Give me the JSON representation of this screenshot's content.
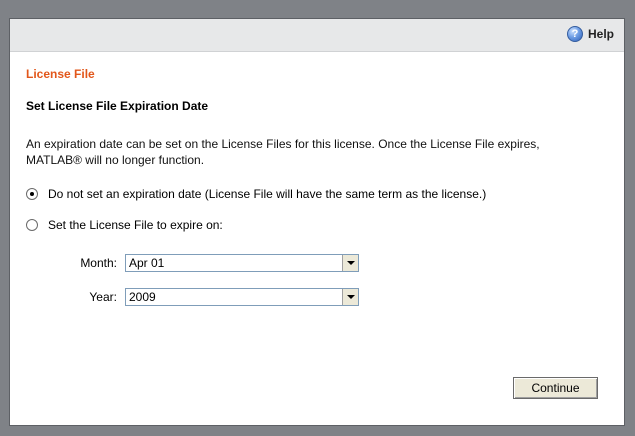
{
  "header": {
    "help_label": "Help",
    "help_icon": "help-icon"
  },
  "section_title": "License File",
  "subtitle": "Set License File Expiration Date",
  "description": "An expiration date can be set on the License Files for this license. Once the License File expires, MATLAB® will no longer function.",
  "options": [
    {
      "label": "Do not set an expiration date (License File will have the same term as the license.)",
      "checked": true
    },
    {
      "label": "Set the License File to expire on:",
      "checked": false
    }
  ],
  "month": {
    "label": "Month:",
    "value": "Apr 01"
  },
  "year": {
    "label": "Year:",
    "value": "2009"
  },
  "continue_label": "Continue",
  "colors": {
    "accent": "#e2571b",
    "outer_background": "#7f8287",
    "topbar": "#e7e8e9"
  }
}
